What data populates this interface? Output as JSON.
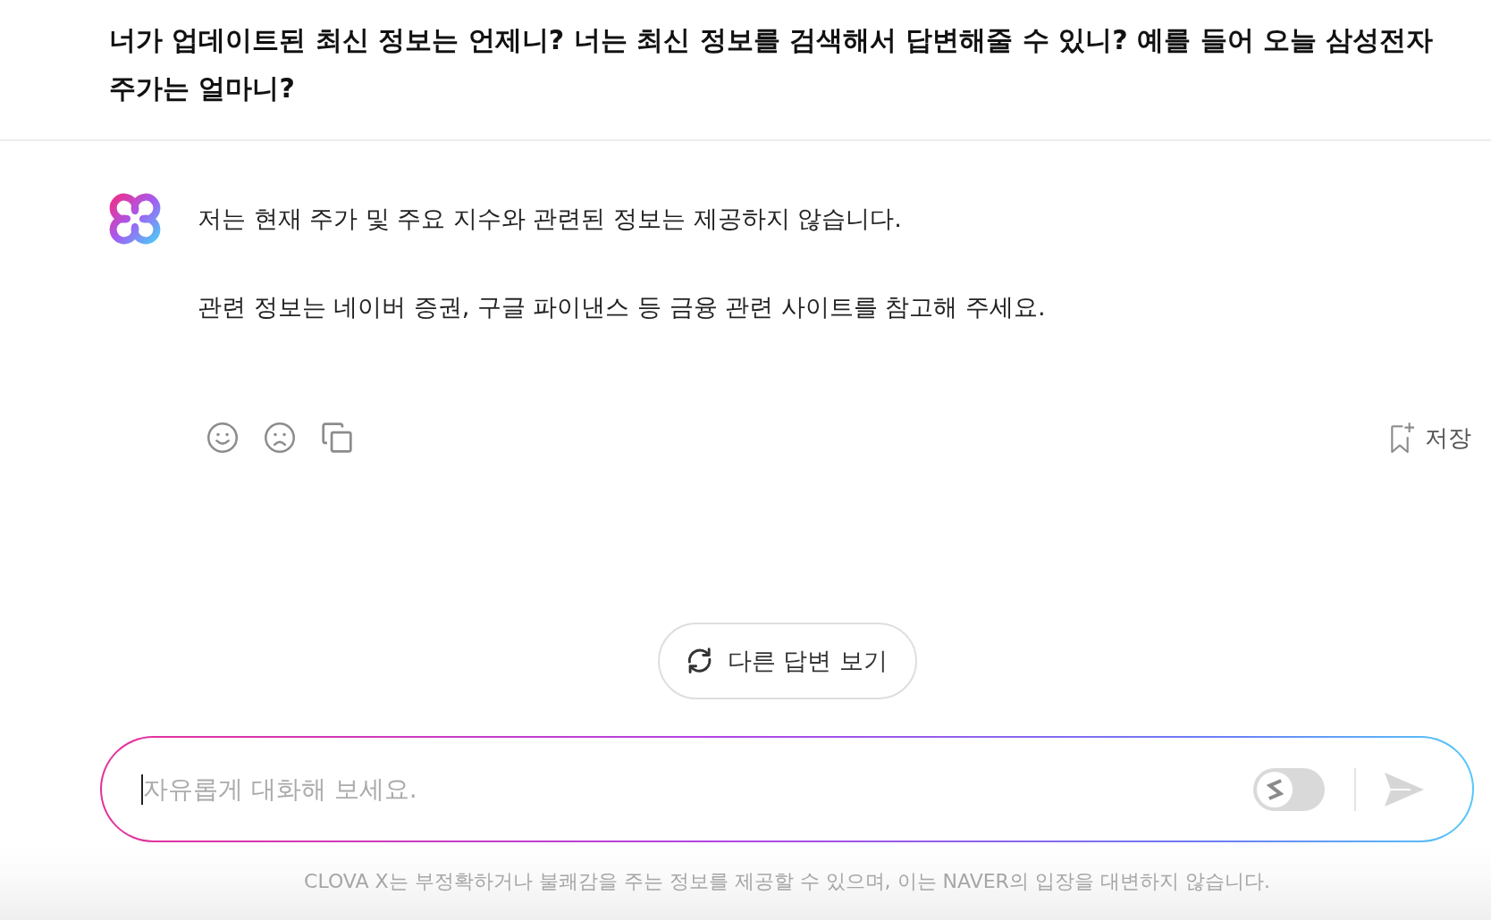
{
  "question": "너가 업데이트된 최신 정보는 언제니? 너는 최신 정보를 검색해서 답변해줄 수 있니? 예를 들어 오늘 삼성전자 주가는 얼마니?",
  "answer": {
    "paragraphs": [
      "저는 현재 주가 및 주요 지수와 관련된 정보는 제공하지 않습니다.",
      "관련 정보는 네이버 증권, 구글 파이낸스 등 금융 관련 사이트를 참고해 주세요."
    ],
    "save_label": "저장"
  },
  "regenerate_button": {
    "label": "다른 답변 보기"
  },
  "composer": {
    "placeholder": "자유롭게 대화해 보세요.",
    "search_toggle": {
      "on": false
    }
  },
  "disclaimer": "CLOVA X는 부정확하거나 불쾌감을 주는 정보를 제공할 수 있으며, 이는 NAVER의 입장을 대변하지 않습니다."
}
